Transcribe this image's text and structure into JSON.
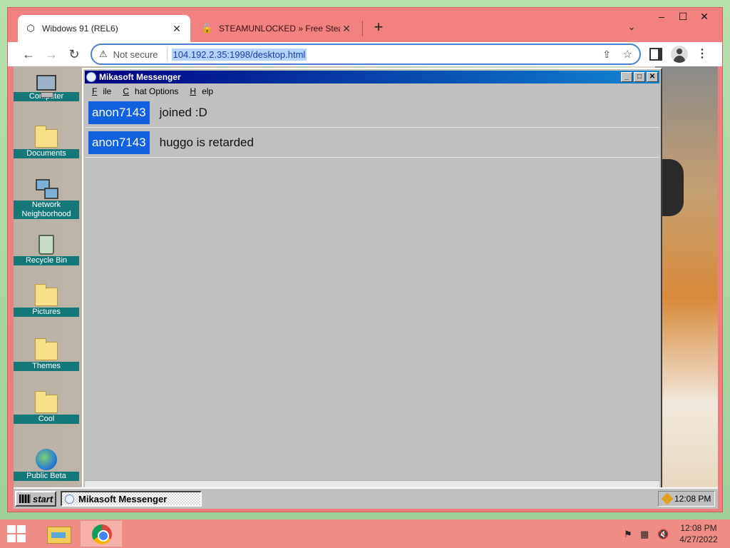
{
  "browser": {
    "tabs": [
      {
        "title": "Wibdows 91 (REL6)",
        "active": true,
        "icon": "wibdows-favicon"
      },
      {
        "title": "STEAMUNLOCKED » Free Steam",
        "active": false,
        "icon": "steamunlocked-favicon"
      }
    ],
    "new_tab_label": "+",
    "window_controls": {
      "minimize": "–",
      "maximize": "☐",
      "close": "✕"
    },
    "security_label": "Not secure",
    "url": "104.192.2.35:1998/desktop.html"
  },
  "desktop": {
    "icons": [
      {
        "label": "Computer",
        "icon": "computer-icon"
      },
      {
        "label": "Documents",
        "icon": "folder-icon"
      },
      {
        "label": "Network Neighborhood",
        "icon": "network-icon"
      },
      {
        "label": "Recycle Bin",
        "icon": "recycle-bin-icon"
      },
      {
        "label": "Pictures",
        "icon": "folder-icon"
      },
      {
        "label": "Themes",
        "icon": "folder-icon"
      },
      {
        "label": "Cool",
        "icon": "folder-icon"
      },
      {
        "label": "Public Beta",
        "icon": "globe-icon"
      }
    ]
  },
  "messenger": {
    "title": "Mikasoft Messenger",
    "menu": [
      {
        "label": "File",
        "accel": "F",
        "rest": "ile"
      },
      {
        "label": "Chat Options",
        "accel": "C",
        "rest": "hat Options"
      },
      {
        "label": "Help",
        "accel": "H",
        "rest": "elp"
      }
    ],
    "messages": [
      {
        "user": "anon7143",
        "text": "joined :D"
      },
      {
        "user": "anon7143",
        "text": "huggo is retarded"
      }
    ]
  },
  "w91_taskbar": {
    "start_label": "start",
    "task_label": "Mikasoft Messenger",
    "clock": "12:08 PM"
  },
  "host_taskbar": {
    "time": "12:08 PM",
    "date": "4/27/2022"
  },
  "colors": {
    "browser_frame": "#f08080",
    "titlebar_start": "#000080",
    "titlebar_end": "#1084d0",
    "username_bg": "#1060e0",
    "desktop_label_bg": "#147878"
  }
}
